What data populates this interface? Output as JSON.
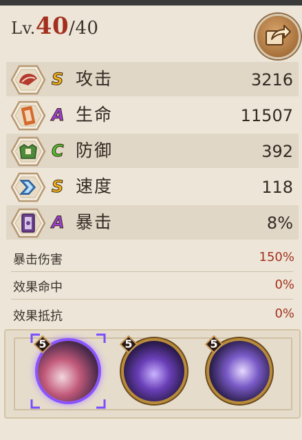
{
  "level": {
    "label": "Lv.",
    "current": "40",
    "max": "/40"
  },
  "stats": [
    {
      "name": "攻击",
      "grade": "S",
      "value": "3216",
      "icon": "fan-icon",
      "grade_color": "#f2b21c"
    },
    {
      "name": "生命",
      "grade": "A",
      "value": "11507",
      "icon": "talisman-icon",
      "grade_color": "#9b3fd6"
    },
    {
      "name": "防御",
      "grade": "C",
      "value": "392",
      "icon": "armor-icon",
      "grade_color": "#4fbf2f"
    },
    {
      "name": "速度",
      "grade": "S",
      "value": "118",
      "icon": "speed-arrow-icon",
      "grade_color": "#f2b21c"
    },
    {
      "name": "暴击",
      "grade": "A",
      "value": "8%",
      "icon": "crit-scroll-icon",
      "grade_color": "#9b3fd6"
    }
  ],
  "substats": [
    {
      "name": "暴击伤害",
      "value": "150%"
    },
    {
      "name": "效果命中",
      "value": "0%"
    },
    {
      "name": "效果抵抗",
      "value": "0%"
    }
  ],
  "skills": [
    {
      "level": "5",
      "selected": true
    },
    {
      "level": "5",
      "selected": false
    },
    {
      "level": "5",
      "selected": false
    }
  ],
  "colors": {
    "accent_red": "#a3301e",
    "panel": "#ede6d8"
  }
}
